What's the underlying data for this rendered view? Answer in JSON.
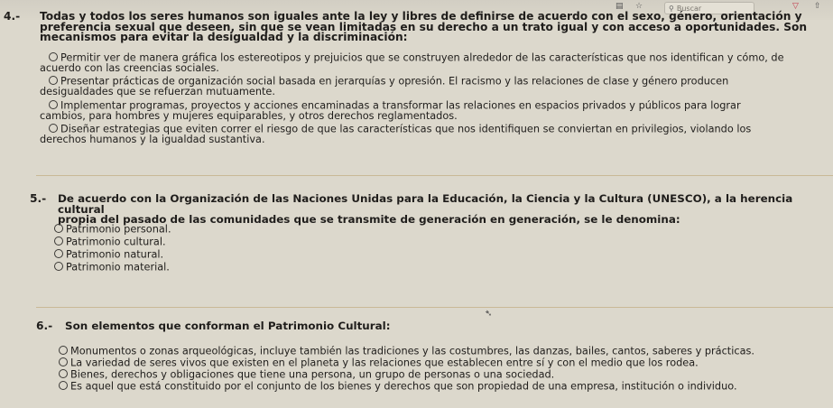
{
  "toolbar": {
    "search_placeholder": "Buscar",
    "icons": [
      "reader-icon",
      "star-icon",
      "search-icon",
      "pocket-icon",
      "share-icon"
    ]
  },
  "questions": [
    {
      "number": "4.-",
      "text": "Todas y todos los seres humanos son iguales ante la ley y libres de definirse de acuerdo con el sexo, género, orientación y\npreferencia sexual que deseen, sin que se vean limitadas en su derecho a un trato igual y con acceso a oportunidades. Son\nmecanismos para evitar la desigualdad y la discriminación:",
      "options": [
        "Permitir ver de manera gráfica los estereotipos y prejuicios que se construyen alrededor de las características que nos identifican y cómo, de\nacuerdo con las creencias sociales.",
        "Presentar prácticas de organización social basada en jerarquías y opresión. El racismo y las relaciones de clase y género producen\ndesigualdades que se refuerzan mutuamente.",
        "Implementar programas, proyectos y acciones encaminadas a transformar las relaciones en espacios privados y públicos para lograr\ncambios, para hombres y mujeres equiparables, y otros derechos reglamentados.",
        "Diseñar estrategias que eviten correr el riesgo de que las características que nos identifiquen se conviertan en privilegios, violando los\nderechos humanos y la igualdad sustantiva."
      ]
    },
    {
      "number": "5.-",
      "text": "De acuerdo con la Organización de las Naciones Unidas para la Educación, la Ciencia y la Cultura (UNESCO), a la herencia cultural\npropia del pasado de las comunidades que se transmite de generación en generación, se le denomina:",
      "options": [
        "Patrimonio personal.",
        "Patrimonio cultural.",
        "Patrimonio natural.",
        "Patrimonio material."
      ]
    },
    {
      "number": "6.-",
      "text": "Son elementos que conforman el Patrimonio Cultural:",
      "options": [
        "Monumentos o zonas arqueológicas, incluye también las tradiciones y las costumbres, las danzas, bailes, cantos, saberes y prácticas.",
        "La variedad de seres vivos que existen en el planeta y las relaciones que establecen entre sí y con el medio que los rodea.",
        "Bienes, derechos y obligaciones que tiene una persona, un grupo de personas o una sociedad.",
        "Es aquel que está constituido por el conjunto de los bienes y derechos que son propiedad de una empresa, institución o individuo."
      ]
    }
  ]
}
